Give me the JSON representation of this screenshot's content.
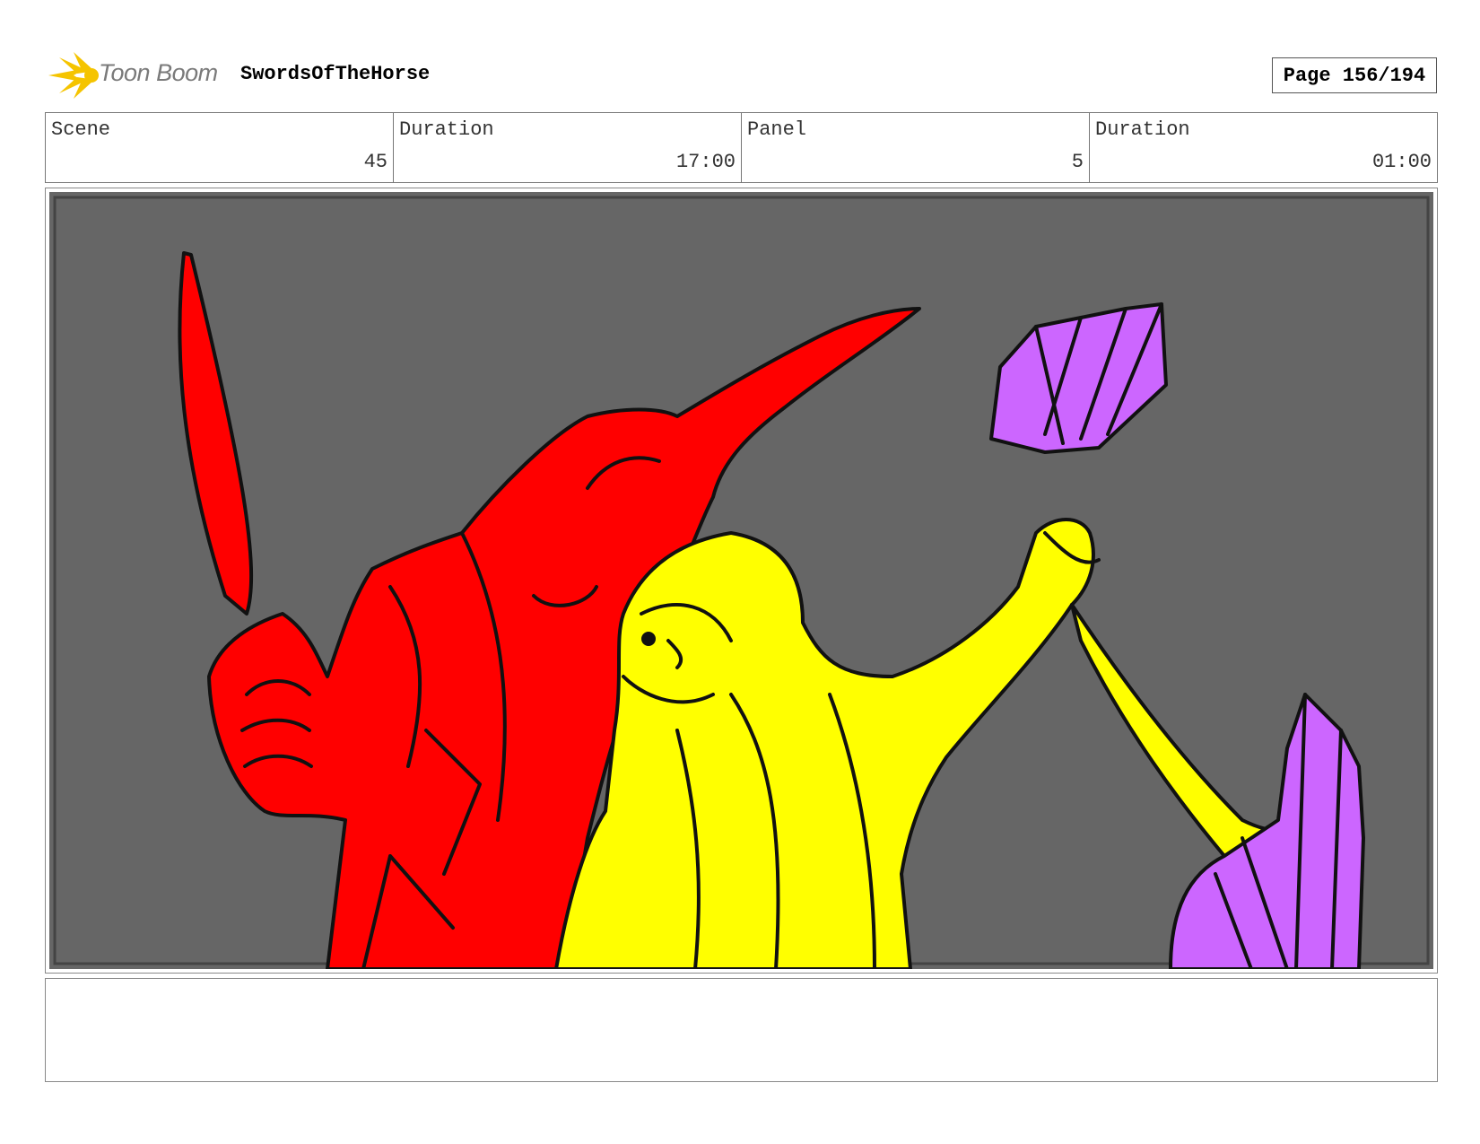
{
  "header": {
    "logo_text": "Toon Boom",
    "project_title": "SwordsOfTheHorse",
    "page_label": "Page 156/194"
  },
  "info": {
    "scene_label": "Scene",
    "scene_value": "45",
    "scene_duration_label": "Duration",
    "scene_duration_value": "17:00",
    "panel_label": "Panel",
    "panel_value": "5",
    "panel_duration_label": "Duration",
    "panel_duration_value": "01:00"
  },
  "colors": {
    "background": "#666666",
    "red_character": "#ff0000",
    "yellow_character": "#ffff00",
    "crystal": "#cc66ff",
    "logo_accent": "#f5c400"
  },
  "notes": {
    "text": ""
  }
}
